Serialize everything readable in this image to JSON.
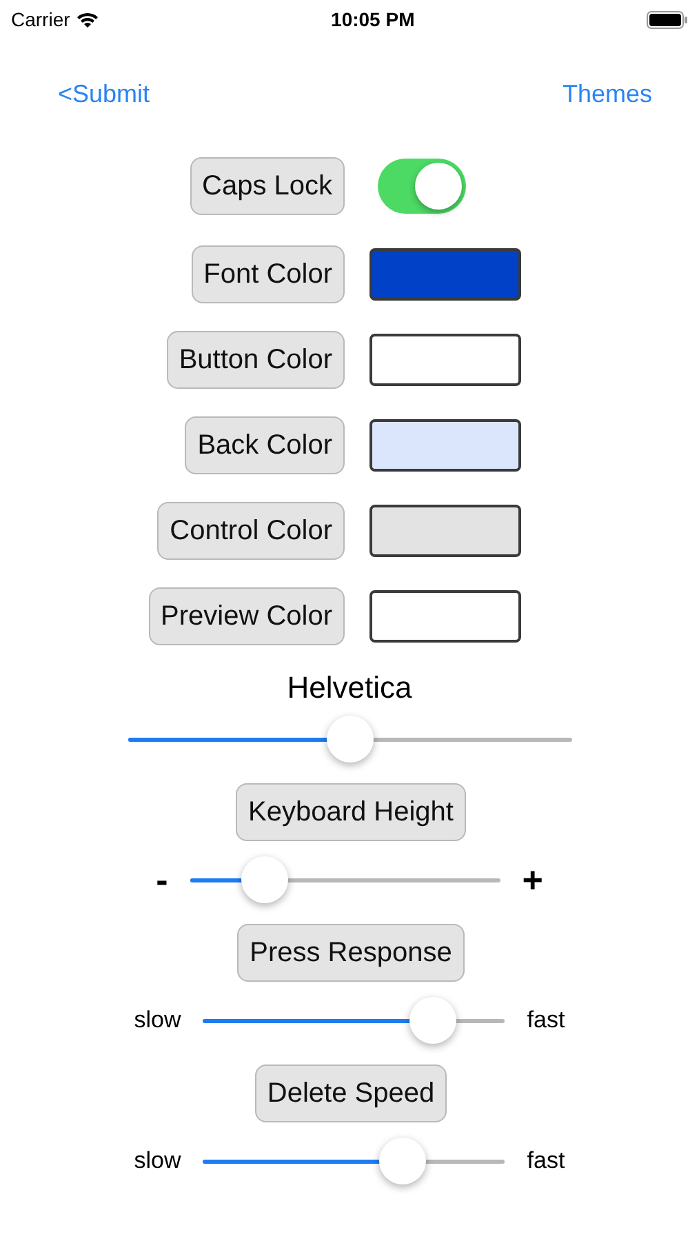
{
  "status_bar": {
    "carrier": "Carrier",
    "time": "10:05 PM"
  },
  "nav": {
    "back": "<Submit",
    "right": "Themes"
  },
  "caps_lock": {
    "label": "Caps Lock",
    "on": true
  },
  "color_rows": [
    {
      "label": "Font Color",
      "color": "#0041c8"
    },
    {
      "label": "Button Color",
      "color": "#ffffff"
    },
    {
      "label": "Back Color",
      "color": "#dbe6fd"
    },
    {
      "label": "Control Color",
      "color": "#e3e3e3"
    },
    {
      "label": "Preview Color",
      "color": "#ffffff"
    }
  ],
  "font_slider": {
    "title": "Helvetica",
    "level": 0.5
  },
  "sections": [
    {
      "button": "Keyboard Height",
      "min_label": "-",
      "max_label": "+",
      "level": 0.24
    },
    {
      "button": "Press Response",
      "min_label": "slow",
      "max_label": "fast",
      "level": 0.76
    },
    {
      "button": "Delete Speed",
      "min_label": "slow",
      "max_label": "fast",
      "level": 0.66
    }
  ]
}
